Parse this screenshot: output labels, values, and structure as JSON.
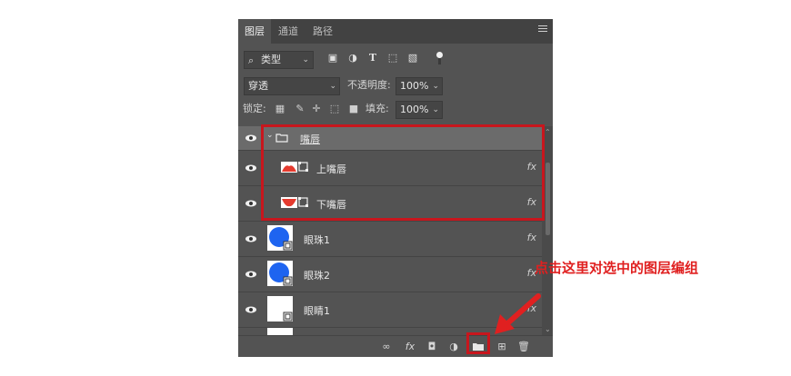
{
  "tabs": [
    "图层",
    "通道",
    "路径"
  ],
  "filter": {
    "label": "类型"
  },
  "blend": {
    "mode": "穿透",
    "opacity_label": "不透明度:",
    "opacity": "100%"
  },
  "lock": {
    "label": "锁定:",
    "fill_label": "填充:",
    "fill": "100%"
  },
  "layers": [
    {
      "name": "嘴唇",
      "type": "group"
    },
    {
      "name": "上嘴唇",
      "fx": "fx"
    },
    {
      "name": "下嘴唇",
      "fx": "fx"
    },
    {
      "name": "眼珠1",
      "fx": "fx"
    },
    {
      "name": "眼珠2",
      "fx": "fx"
    },
    {
      "name": "眼睛1",
      "fx": "fx"
    }
  ],
  "bottom": {
    "fx": "fx"
  },
  "callout": "点击这里对选中的图层编组",
  "colors": {
    "highlight": "#c8161d",
    "lip": "#e53b2f",
    "eyeball": "#1e64f0"
  }
}
